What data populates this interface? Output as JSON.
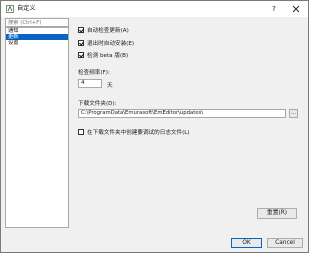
{
  "window": {
    "title": "自定义",
    "help_label": "?"
  },
  "sidebar": {
    "search_placeholder": "搜索 (Ctrl+F)",
    "items": [
      {
        "label": "通知",
        "selected": false
      },
      {
        "label": "更新",
        "selected": true
      },
      {
        "label": "设置",
        "selected": false
      }
    ]
  },
  "update": {
    "auto_check_label": "自动检查更新(A)",
    "auto_check_checked": true,
    "auto_install_on_exit_label": "退出时自动安装(E)",
    "auto_install_on_exit_checked": true,
    "check_beta_label": "检测 beta 版(B)",
    "check_beta_checked": true,
    "frequency_label": "检查频率(F):",
    "frequency_value": "4",
    "frequency_unit": "天",
    "download_folder_label": "下载文件夹(D):",
    "download_folder_value": "C:\\ProgramData\\Emurasoft\\EmEditor\\updates\\",
    "browse_label": "...",
    "create_debug_log_label": "在下载文件夹中创建要调试的日志文件(L)",
    "create_debug_log_checked": false,
    "reset_label": "重置(R)"
  },
  "footer": {
    "ok_label": "OK",
    "cancel_label": "Cancel"
  },
  "colors": {
    "accent": "#0a64c8",
    "dialog_bg": "#f0f0f0"
  },
  "icons": {
    "app": "emeditor-app-icon",
    "close": "close-icon",
    "checkbox": "checkmark-icon"
  }
}
